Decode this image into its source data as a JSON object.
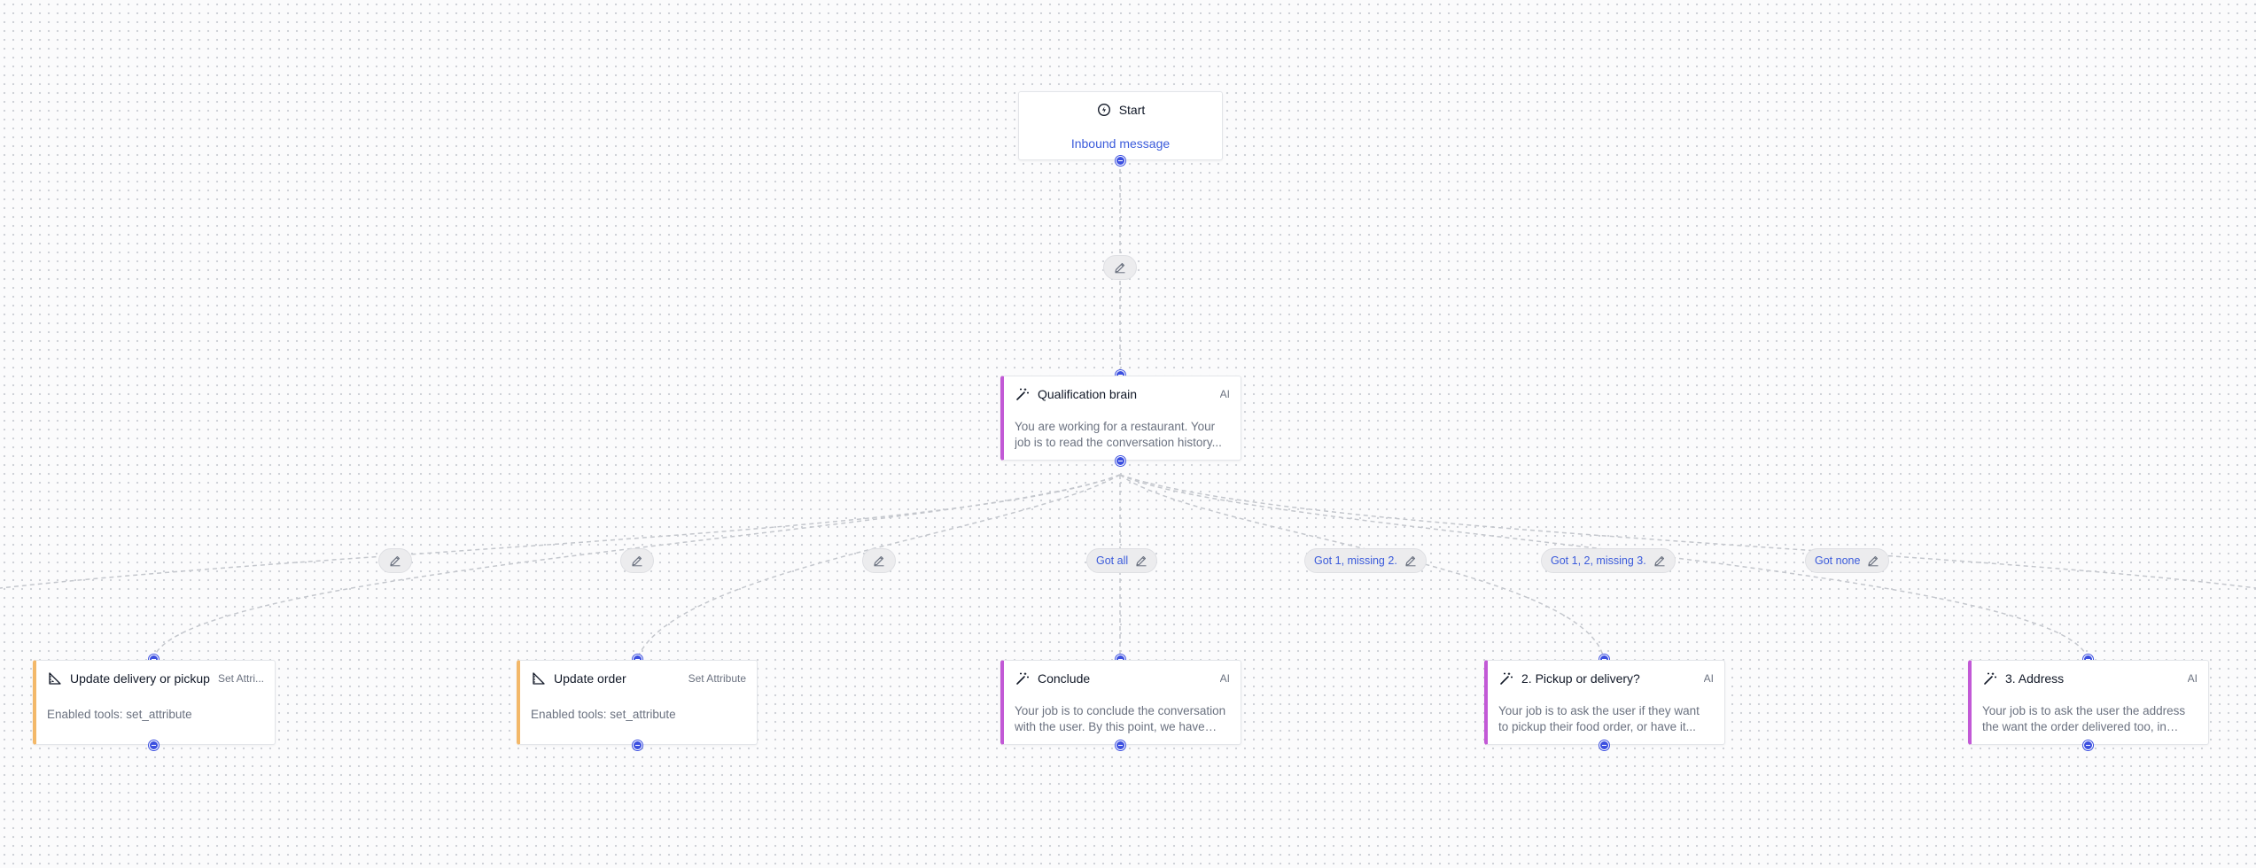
{
  "canvas": {
    "background": "#fbfbfc",
    "dot_color": "#cfd2d8",
    "edge_color": "#c4c7cd",
    "handle_color": "#3b4fe0"
  },
  "start": {
    "title": "Start",
    "link": "Inbound message",
    "icon": "power-icon"
  },
  "brain": {
    "title": "Qualification brain",
    "tag": "AI",
    "body": "You are working for a restaurant. Your job is to read the conversation history...",
    "icon": "magic-wand-icon"
  },
  "first_edge": {
    "label": ""
  },
  "branches": [
    {
      "label": ""
    },
    {
      "label": ""
    },
    {
      "label": ""
    },
    {
      "label": "Got all"
    },
    {
      "label": "Got 1, missing 2."
    },
    {
      "label": "Got 1, 2, missing 3."
    },
    {
      "label": "Got none"
    }
  ],
  "nodes": [
    {
      "title": "Update delivery or pickup",
      "tag": "Set Attri...",
      "body": "Enabled tools: set_attribute",
      "kind": "attr",
      "icon": "ruler-triangle-icon"
    },
    {
      "title": "Update order",
      "tag": "Set Attribute",
      "body": "Enabled tools: set_attribute",
      "kind": "attr",
      "icon": "ruler-triangle-icon"
    },
    {
      "title": "Conclude",
      "tag": "AI",
      "body": "Your job is to conclude the conversation with the user. By this point, we have all...",
      "kind": "ai",
      "icon": "magic-wand-icon"
    },
    {
      "title": "2. Pickup or delivery?",
      "tag": "AI",
      "body": "Your job is to ask the user if they want to pickup their food order, or have it...",
      "kind": "ai",
      "icon": "magic-wand-icon"
    },
    {
      "title": "3. Address",
      "tag": "AI",
      "body": "Your job is to ask the user the address the want the order delivered too, in the...",
      "kind": "ai",
      "icon": "magic-wand-icon"
    }
  ]
}
